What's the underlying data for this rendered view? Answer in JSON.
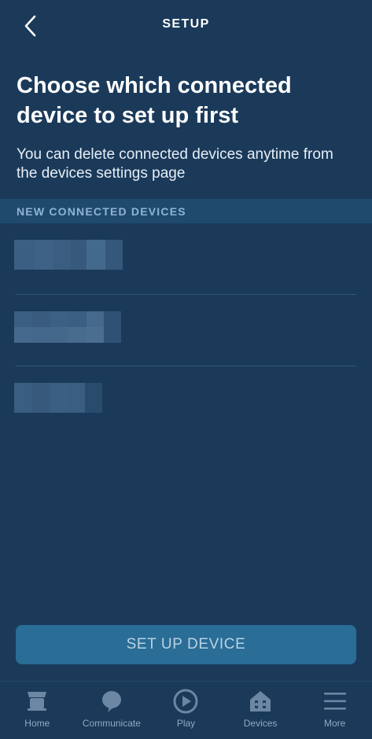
{
  "header": {
    "title": "SETUP",
    "back_icon": "chevron-left-icon"
  },
  "main": {
    "title": "Choose which connected device to set up first",
    "subtitle": "You can delete connected devices anytime from the devices settings page",
    "section_label": "NEW CONNECTED DEVICES",
    "devices": [
      {
        "name": "",
        "note": "name pixelated / obscured"
      },
      {
        "name": "",
        "note": "name pixelated / obscured"
      },
      {
        "name": "",
        "note": "name pixelated / obscured"
      }
    ]
  },
  "action": {
    "setup_label": "SET UP DEVICE"
  },
  "bottom_nav": {
    "items": [
      {
        "label": "Home",
        "icon": "home-icon"
      },
      {
        "label": "Communicate",
        "icon": "chat-bubble-icon"
      },
      {
        "label": "Play",
        "icon": "play-icon"
      },
      {
        "label": "Devices",
        "icon": "devices-icon"
      },
      {
        "label": "More",
        "icon": "menu-icon"
      }
    ]
  },
  "colors": {
    "background": "#1b3a5a",
    "section_band": "#1f4a6e",
    "section_text": "#8fb4d3",
    "button_bg": "#2a6d96",
    "button_text": "#b7d3e6",
    "nav_inactive": "#8fa9c2"
  }
}
